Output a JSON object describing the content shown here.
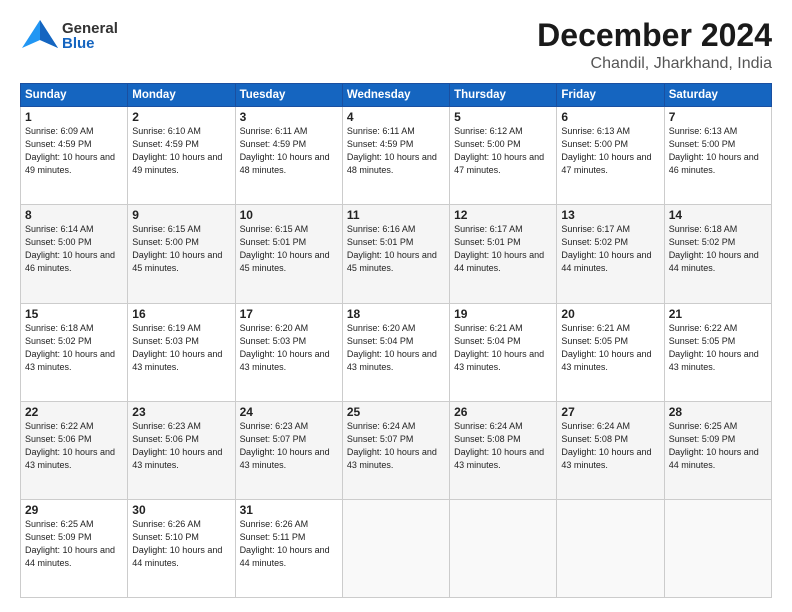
{
  "header": {
    "logo_line1": "General",
    "logo_line2": "Blue",
    "month_title": "December 2024",
    "location": "Chandil, Jharkhand, India"
  },
  "weekdays": [
    "Sunday",
    "Monday",
    "Tuesday",
    "Wednesday",
    "Thursday",
    "Friday",
    "Saturday"
  ],
  "weeks": [
    [
      {
        "day": "1",
        "sunrise": "6:09 AM",
        "sunset": "4:59 PM",
        "daylight": "10 hours and 49 minutes."
      },
      {
        "day": "2",
        "sunrise": "6:10 AM",
        "sunset": "4:59 PM",
        "daylight": "10 hours and 49 minutes."
      },
      {
        "day": "3",
        "sunrise": "6:11 AM",
        "sunset": "4:59 PM",
        "daylight": "10 hours and 48 minutes."
      },
      {
        "day": "4",
        "sunrise": "6:11 AM",
        "sunset": "4:59 PM",
        "daylight": "10 hours and 48 minutes."
      },
      {
        "day": "5",
        "sunrise": "6:12 AM",
        "sunset": "5:00 PM",
        "daylight": "10 hours and 47 minutes."
      },
      {
        "day": "6",
        "sunrise": "6:13 AM",
        "sunset": "5:00 PM",
        "daylight": "10 hours and 47 minutes."
      },
      {
        "day": "7",
        "sunrise": "6:13 AM",
        "sunset": "5:00 PM",
        "daylight": "10 hours and 46 minutes."
      }
    ],
    [
      {
        "day": "8",
        "sunrise": "6:14 AM",
        "sunset": "5:00 PM",
        "daylight": "10 hours and 46 minutes."
      },
      {
        "day": "9",
        "sunrise": "6:15 AM",
        "sunset": "5:00 PM",
        "daylight": "10 hours and 45 minutes."
      },
      {
        "day": "10",
        "sunrise": "6:15 AM",
        "sunset": "5:01 PM",
        "daylight": "10 hours and 45 minutes."
      },
      {
        "day": "11",
        "sunrise": "6:16 AM",
        "sunset": "5:01 PM",
        "daylight": "10 hours and 45 minutes."
      },
      {
        "day": "12",
        "sunrise": "6:17 AM",
        "sunset": "5:01 PM",
        "daylight": "10 hours and 44 minutes."
      },
      {
        "day": "13",
        "sunrise": "6:17 AM",
        "sunset": "5:02 PM",
        "daylight": "10 hours and 44 minutes."
      },
      {
        "day": "14",
        "sunrise": "6:18 AM",
        "sunset": "5:02 PM",
        "daylight": "10 hours and 44 minutes."
      }
    ],
    [
      {
        "day": "15",
        "sunrise": "6:18 AM",
        "sunset": "5:02 PM",
        "daylight": "10 hours and 43 minutes."
      },
      {
        "day": "16",
        "sunrise": "6:19 AM",
        "sunset": "5:03 PM",
        "daylight": "10 hours and 43 minutes."
      },
      {
        "day": "17",
        "sunrise": "6:20 AM",
        "sunset": "5:03 PM",
        "daylight": "10 hours and 43 minutes."
      },
      {
        "day": "18",
        "sunrise": "6:20 AM",
        "sunset": "5:04 PM",
        "daylight": "10 hours and 43 minutes."
      },
      {
        "day": "19",
        "sunrise": "6:21 AM",
        "sunset": "5:04 PM",
        "daylight": "10 hours and 43 minutes."
      },
      {
        "day": "20",
        "sunrise": "6:21 AM",
        "sunset": "5:05 PM",
        "daylight": "10 hours and 43 minutes."
      },
      {
        "day": "21",
        "sunrise": "6:22 AM",
        "sunset": "5:05 PM",
        "daylight": "10 hours and 43 minutes."
      }
    ],
    [
      {
        "day": "22",
        "sunrise": "6:22 AM",
        "sunset": "5:06 PM",
        "daylight": "10 hours and 43 minutes."
      },
      {
        "day": "23",
        "sunrise": "6:23 AM",
        "sunset": "5:06 PM",
        "daylight": "10 hours and 43 minutes."
      },
      {
        "day": "24",
        "sunrise": "6:23 AM",
        "sunset": "5:07 PM",
        "daylight": "10 hours and 43 minutes."
      },
      {
        "day": "25",
        "sunrise": "6:24 AM",
        "sunset": "5:07 PM",
        "daylight": "10 hours and 43 minutes."
      },
      {
        "day": "26",
        "sunrise": "6:24 AM",
        "sunset": "5:08 PM",
        "daylight": "10 hours and 43 minutes."
      },
      {
        "day": "27",
        "sunrise": "6:24 AM",
        "sunset": "5:08 PM",
        "daylight": "10 hours and 43 minutes."
      },
      {
        "day": "28",
        "sunrise": "6:25 AM",
        "sunset": "5:09 PM",
        "daylight": "10 hours and 44 minutes."
      }
    ],
    [
      {
        "day": "29",
        "sunrise": "6:25 AM",
        "sunset": "5:09 PM",
        "daylight": "10 hours and 44 minutes."
      },
      {
        "day": "30",
        "sunrise": "6:26 AM",
        "sunset": "5:10 PM",
        "daylight": "10 hours and 44 minutes."
      },
      {
        "day": "31",
        "sunrise": "6:26 AM",
        "sunset": "5:11 PM",
        "daylight": "10 hours and 44 minutes."
      },
      null,
      null,
      null,
      null
    ]
  ]
}
